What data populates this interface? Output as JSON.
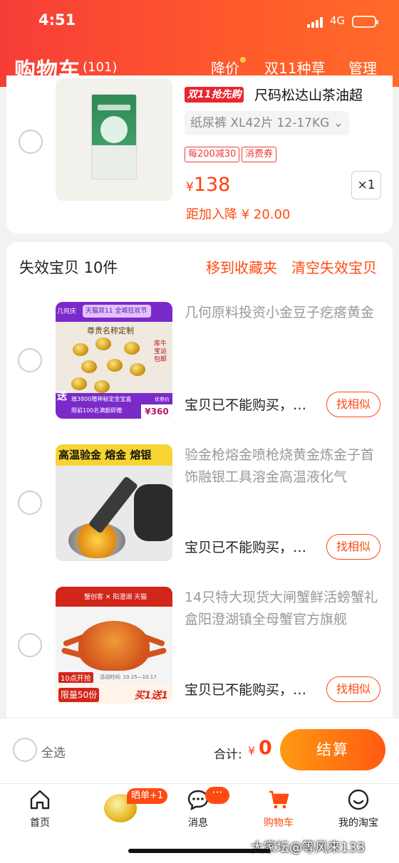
{
  "status_bar": {
    "time": "4:51",
    "network": "4G"
  },
  "header": {
    "title": "购物车",
    "count": "(101)",
    "nav": [
      "降价",
      "双11种草",
      "管理"
    ]
  },
  "cart_item": {
    "promo_tag": "双11抢先购",
    "name": "尺码松达山茶油超",
    "sku": "纸尿裤 XL42片 12-17KG",
    "badges": [
      "每200减30",
      "消费券"
    ],
    "currency": "¥",
    "price": "138",
    "quantity": "×1",
    "reduce_text": "距加入降 ¥ 20.00"
  },
  "invalid_section": {
    "title": "失效宝贝 10件",
    "move_label": "移到收藏夹",
    "clear_label": "清空失效宝贝",
    "items": [
      {
        "name": "几何原料投资小金豆子疙瘩黄金",
        "status": "宝贝已不能购买，…",
        "similar": "找相似",
        "thumb_text": {
          "brand": "几何庆",
          "header": "天猫双11 全城狂欢节",
          "title": "尊贵名称定制",
          "side": "库牛 宝运 包邮",
          "gift": "送",
          "footer": "填3800赠神秘定金宝盒",
          "footer2": "限前100名满额即赠",
          "price_label": "优券价",
          "price": "¥360"
        }
      },
      {
        "name": "验金枪熔金喷枪烧黄金炼金子首饰融银工具溶金高温液化气",
        "status": "宝贝已不能购买，…",
        "similar": "找相似",
        "thumb_text": {
          "header": "高温验金 熔金 熔银"
        }
      },
      {
        "name": "14只特大现货大闸蟹鲜活螃蟹礼盒阳澄湖镇全母蟹官方旗舰",
        "status": "宝贝已不能购买，…",
        "similar": "找相似",
        "thumb_text": {
          "header": "蟹创客 ✕ 阳澄湖 天猫",
          "footer1": "10点开抢",
          "footer_small": "活动时间: 10.15—10.17",
          "footer2": "限量50份",
          "footer3": "买1送1"
        }
      }
    ]
  },
  "bottom_bar": {
    "select_all": "全选",
    "total_label": "合计:",
    "currency": "¥",
    "total": "0",
    "checkout": "结算"
  },
  "tabbar": {
    "promo_badge": "晒单+1",
    "msg_badge": "···",
    "tabs": [
      "首页",
      "消息",
      "购物车",
      "我的淘宝"
    ]
  },
  "watermark": "大家坛@等风来133",
  "colors": {
    "accent": "#ff4a12",
    "header_start": "#f63d37",
    "header_end": "#ff6a28",
    "price": "#ff3f0f"
  }
}
